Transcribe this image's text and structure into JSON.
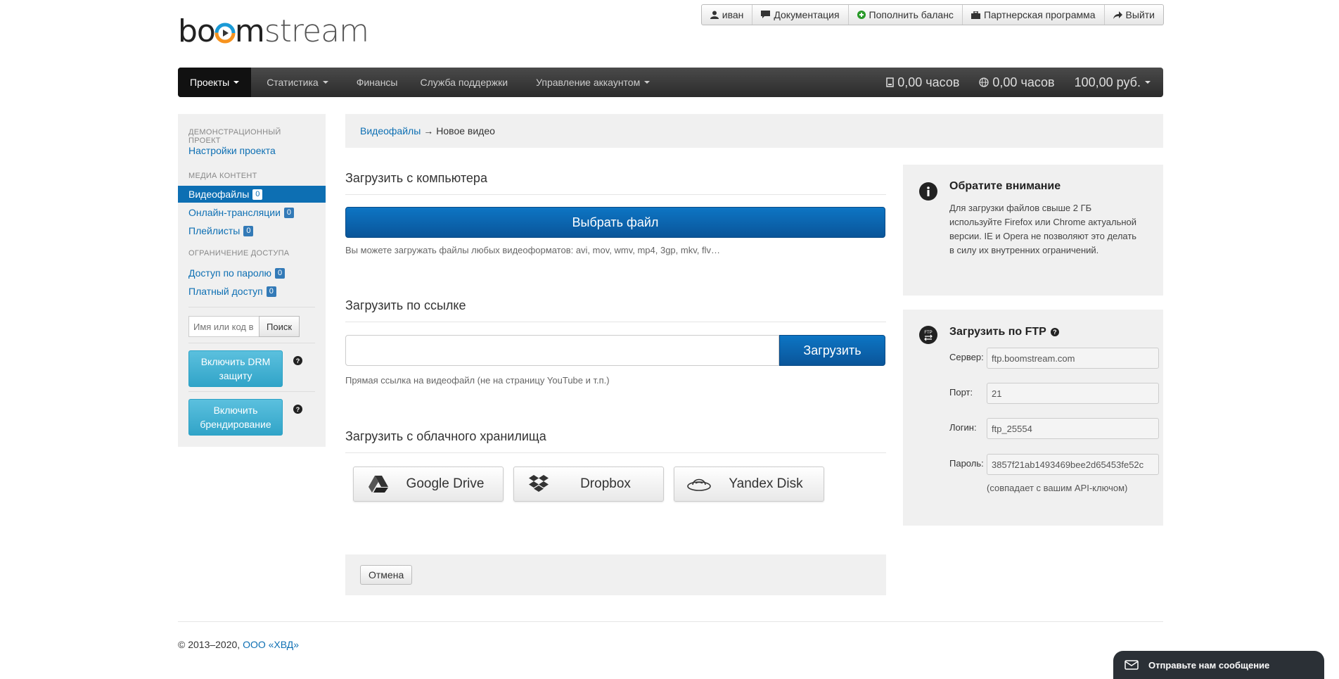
{
  "logo": {
    "part1": "bo",
    "part2": "m",
    "part3": "stream"
  },
  "userbar": {
    "user": "иван",
    "docs": "Документация",
    "topup": "Пополнить баланс",
    "partner": "Партнерская программа",
    "logout": "Выйти"
  },
  "nav": {
    "projects": "Проекты",
    "stats": "Статистика",
    "finance": "Финансы",
    "support": "Служба поддержки",
    "account": "Управление аккаунтом",
    "storage_hours": "0,00 часов",
    "traffic_hours": "0,00 часов",
    "balance": "100,00 руб."
  },
  "sidebar": {
    "project_head": "Демонстрационный проект",
    "project_settings": "Настройки проекта",
    "media_head": "Медиа контент",
    "videos": {
      "label": "Видеофайлы",
      "count": "0"
    },
    "streams": {
      "label": "Онлайн-трансляции",
      "count": "0"
    },
    "playlists": {
      "label": "Плейлисты",
      "count": "0"
    },
    "access_head": "Ограничение доступа",
    "password_access": {
      "label": "Доступ по паролю",
      "count": "0"
    },
    "paid_access": {
      "label": "Платный доступ",
      "count": "0"
    },
    "search_placeholder": "Имя или код в",
    "search_button": "Поиск",
    "drm_button": "Включить DRM защиту",
    "branding_button": "Включить брендирование",
    "help": "?"
  },
  "breadcrumb": {
    "link": "Видеофайлы",
    "arrow": "→",
    "current": "Новое видео"
  },
  "upload_computer": {
    "title": "Загрузить с компьютера",
    "button": "Выбрать файл",
    "hint": "Вы можете загружать файлы любых видеоформатов: avi, mov, wmv, mp4, 3gp, mkv, flv…"
  },
  "upload_link": {
    "title": "Загрузить по ссылке",
    "value": "",
    "button": "Загрузить",
    "hint": "Прямая ссылка на видеофайл (не на страницу YouTube и т.п.)"
  },
  "upload_cloud": {
    "title": "Загрузить с облачного хранилища",
    "providers": [
      {
        "label": "Google Drive",
        "icon": "google-drive-icon"
      },
      {
        "label": "Dropbox",
        "icon": "dropbox-icon"
      },
      {
        "label": "Yandex Disk",
        "icon": "yandex-disk-icon"
      }
    ]
  },
  "cancel": "Отмена",
  "notice": {
    "title": "Обратите внимание",
    "text": "Для загрузки файлов свыше 2 ГБ используйте Firefox или Chrome актуальной версии. IE и Opera не позволяют это делать в силу их внутренних ограничений."
  },
  "ftp": {
    "title": "Загрузить по FTP",
    "help": "?",
    "server_label": "Сервер:",
    "server": "ftp.boomstream.com",
    "port_label": "Порт:",
    "port": "21",
    "login_label": "Логин:",
    "login": "ftp_25554",
    "password_label": "Пароль:",
    "password": "3857f21ab1493469bee2d65453fe52c",
    "note": "(совпадает с вашим API-ключом)"
  },
  "footer": {
    "copyright": "© 2013–2020,",
    "company": "ООО «ХВД»"
  },
  "chat": {
    "label": "Отправьте нам сообщение"
  },
  "colors": {
    "primary": "#0d6fb3",
    "button_blue": "#0a5599",
    "info_button": "#5bc0de",
    "navbar": "#333333"
  }
}
